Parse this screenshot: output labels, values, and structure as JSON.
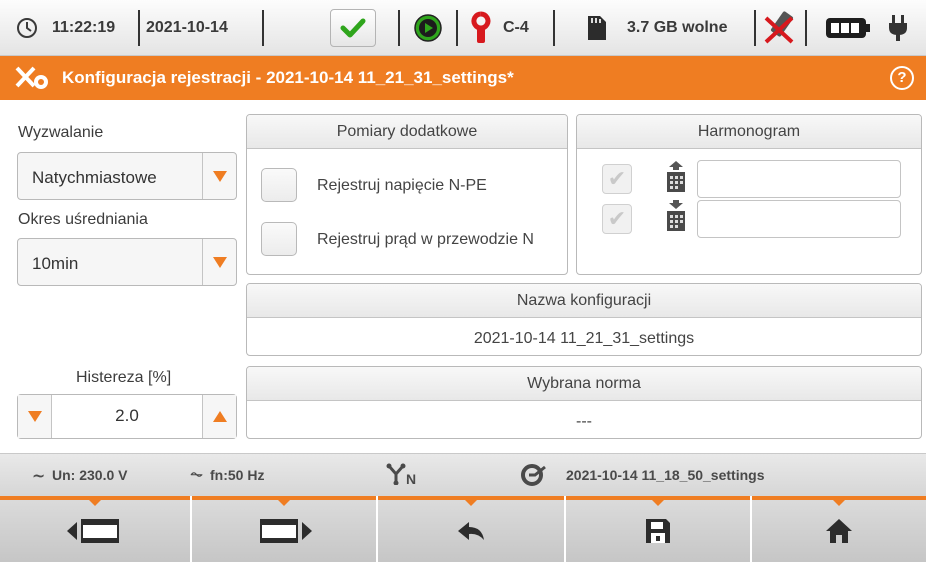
{
  "status": {
    "time": "11:22:19",
    "date": "2021-10-14",
    "clamp": "C-4",
    "storage": "3.7 GB wolne",
    "icons": [
      "clock-icon",
      "check-icon",
      "record-icon",
      "clamp-icon",
      "sdcard-icon",
      "usb-icon",
      "battery-icon",
      "plug-icon"
    ],
    "colors": {
      "check": "#2fa51c",
      "record": "#2fa51c",
      "clamp": "#d7191e",
      "usb_cross": "#d7191e"
    }
  },
  "header": {
    "title": "Konfiguracja rejestracji - 2021-10-14 11_21_31_settings*",
    "help": "?",
    "icon": "tools-icon",
    "accent": "#ef7d22"
  },
  "trigger": {
    "label": "Wyzwalanie",
    "value": "Natychmiastowe"
  },
  "averaging": {
    "label": "Okres uśredniania",
    "value": "10min"
  },
  "hysteresis": {
    "label": "Histereza [%]",
    "value": "2.0"
  },
  "extra": {
    "title": "Pomiary dodatkowe",
    "items": [
      {
        "label": "Rejestruj napięcie N-PE",
        "checked": false
      },
      {
        "label": "Rejestruj prąd w przewodzie N",
        "checked": false
      }
    ]
  },
  "schedule": {
    "title": "Harmonogram",
    "rows": [
      {
        "icon": "calendar-start-icon",
        "value": ""
      },
      {
        "icon": "calendar-end-icon",
        "value": ""
      }
    ]
  },
  "config_name": {
    "title": "Nazwa konfiguracji",
    "value": "2021-10-14 11_21_31_settings"
  },
  "norm": {
    "title": "Wybrana norma",
    "value": "---"
  },
  "info": {
    "un": "Un: 230.0 V",
    "fn": "fn:50 Hz",
    "network": "N",
    "settings": "2021-10-14 11_18_50_settings"
  },
  "toolbar": [
    "prev-screen-button",
    "next-screen-button",
    "back-button",
    "save-button",
    "home-button"
  ]
}
